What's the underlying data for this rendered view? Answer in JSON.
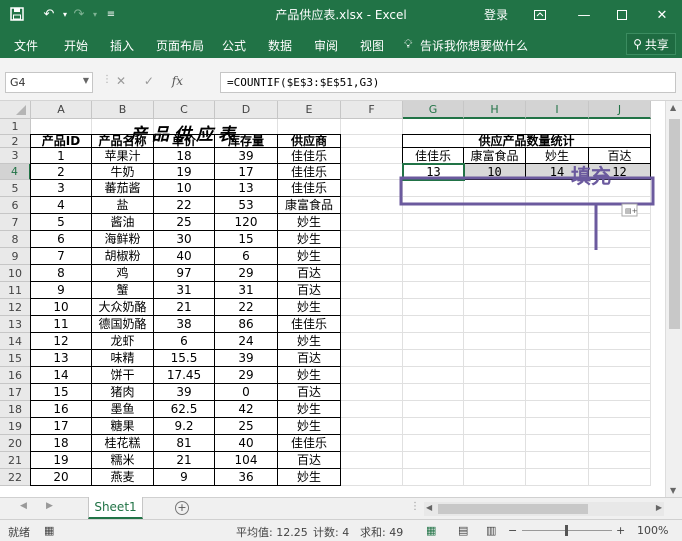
{
  "window": {
    "title": "产品供应表.xlsx  -  Excel",
    "login": "登录"
  },
  "ribbon": {
    "tabs": [
      "文件",
      "开始",
      "插入",
      "页面布局",
      "公式",
      "数据",
      "审阅",
      "视图"
    ],
    "tell_me": "告诉我你想要做什么",
    "share": "共享"
  },
  "formula_bar": {
    "name_box": "G4",
    "formula": "=COUNTIF($E$3:$E$51,G3)"
  },
  "columns": [
    "A",
    "B",
    "C",
    "D",
    "E",
    "F",
    "G",
    "H",
    "I",
    "J"
  ],
  "rows": [
    "1",
    "2",
    "3",
    "4",
    "5",
    "6",
    "7",
    "8",
    "9",
    "10",
    "11",
    "12",
    "13",
    "14",
    "15",
    "16",
    "17",
    "18",
    "19",
    "20",
    "21",
    "22"
  ],
  "table": {
    "title": "产品供应表",
    "headers": [
      "产品ID",
      "产品名称",
      "单价",
      "库存量",
      "供应商"
    ],
    "data": [
      [
        "1",
        "苹果汁",
        "18",
        "39",
        "佳佳乐"
      ],
      [
        "2",
        "牛奶",
        "19",
        "17",
        "佳佳乐"
      ],
      [
        "3",
        "蕃茄酱",
        "10",
        "13",
        "佳佳乐"
      ],
      [
        "4",
        "盐",
        "22",
        "53",
        "康富食品"
      ],
      [
        "5",
        "酱油",
        "25",
        "120",
        "妙生"
      ],
      [
        "6",
        "海鲜粉",
        "30",
        "15",
        "妙生"
      ],
      [
        "7",
        "胡椒粉",
        "40",
        "6",
        "妙生"
      ],
      [
        "8",
        "鸡",
        "97",
        "29",
        "百达"
      ],
      [
        "9",
        "蟹",
        "31",
        "31",
        "百达"
      ],
      [
        "10",
        "大众奶酪",
        "21",
        "22",
        "妙生"
      ],
      [
        "11",
        "德国奶酪",
        "38",
        "86",
        "佳佳乐"
      ],
      [
        "12",
        "龙虾",
        "6",
        "24",
        "妙生"
      ],
      [
        "13",
        "味精",
        "15.5",
        "39",
        "百达"
      ],
      [
        "14",
        "饼干",
        "17.45",
        "29",
        "妙生"
      ],
      [
        "15",
        "猪肉",
        "39",
        "0",
        "百达"
      ],
      [
        "16",
        "墨鱼",
        "62.5",
        "42",
        "妙生"
      ],
      [
        "17",
        "糖果",
        "9.2",
        "25",
        "妙生"
      ],
      [
        "18",
        "桂花糕",
        "81",
        "40",
        "佳佳乐"
      ],
      [
        "19",
        "糯米",
        "21",
        "104",
        "百达"
      ],
      [
        "20",
        "燕麦",
        "9",
        "36",
        "妙生"
      ]
    ]
  },
  "stats": {
    "title": "供应产品数量统计",
    "suppliers": [
      "佳佳乐",
      "康富食品",
      "妙生",
      "百达"
    ],
    "counts": [
      "13",
      "10",
      "14",
      "12"
    ]
  },
  "callout": {
    "label": "填充",
    "color": "#6b5a9e"
  },
  "sheet_tabs": {
    "active": "Sheet1"
  },
  "status": {
    "mode": "就绪",
    "average": "平均值: 12.25",
    "count": "计数: 4",
    "sum": "求和: 49",
    "zoom": "100%"
  }
}
